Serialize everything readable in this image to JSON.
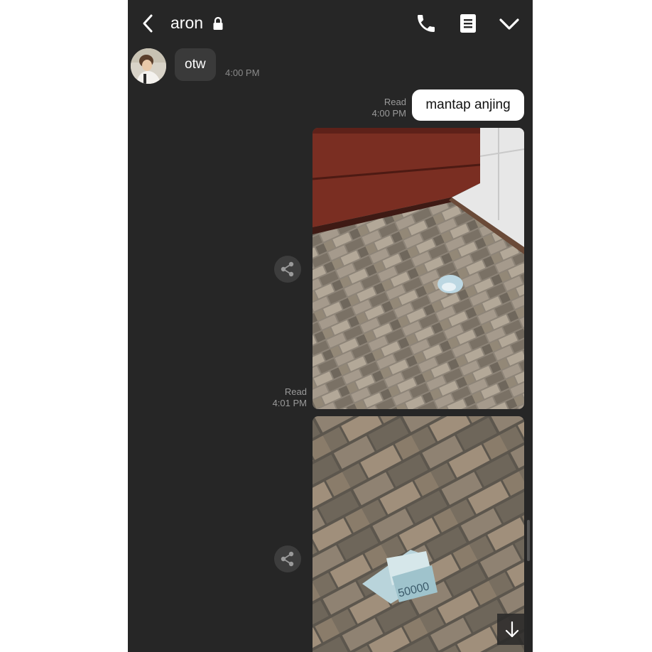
{
  "header": {
    "title": "aron",
    "icons": [
      "back-icon",
      "lock-icon",
      "phone-icon",
      "notes-icon",
      "chevron-down-icon"
    ]
  },
  "messages": [
    {
      "direction": "incoming",
      "text": "otw",
      "time": "4:00 PM"
    },
    {
      "direction": "outgoing",
      "text": "mantap anjing",
      "status": "Read",
      "time": "4:00 PM"
    },
    {
      "direction": "outgoing",
      "type": "photo",
      "status": "Read",
      "time": "4:01 PM"
    },
    {
      "direction": "outgoing",
      "type": "photo",
      "banknote_text": "50000"
    }
  ],
  "colors": {
    "background": "#262626",
    "incoming_bubble": "#3a3a3a",
    "outgoing_bubble": "#ffffff",
    "meta_text": "#9a9a9a"
  }
}
